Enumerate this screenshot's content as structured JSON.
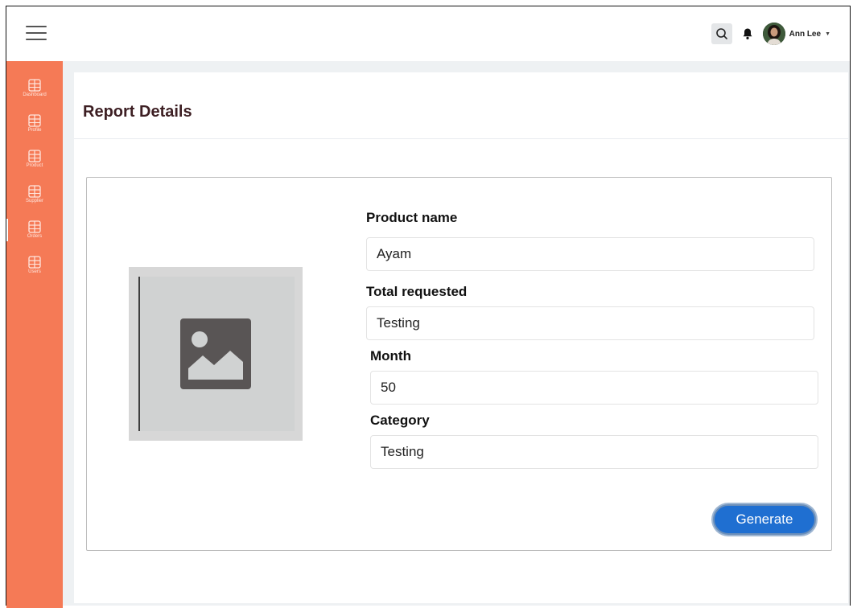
{
  "header": {
    "user_name": "Ann Lee"
  },
  "sidebar": {
    "items": [
      {
        "label": "Dashboard",
        "icon": "grid-icon"
      },
      {
        "label": "Profile",
        "icon": "grid-icon"
      },
      {
        "label": "Product",
        "icon": "grid-icon"
      },
      {
        "label": "Supplier",
        "icon": "grid-icon"
      },
      {
        "label": "Orders",
        "icon": "grid-icon"
      },
      {
        "label": "Users",
        "icon": "grid-icon"
      }
    ],
    "accent_color": "#f57a56"
  },
  "page": {
    "title": "Report Details"
  },
  "form": {
    "product_name": {
      "label": "Product name",
      "value": "Ayam"
    },
    "total_requested": {
      "label": "Total requested",
      "value": "Testing"
    },
    "month": {
      "label": "Month",
      "value": "50"
    },
    "category": {
      "label": "Category",
      "value": "Testing"
    },
    "generate_label": "Generate"
  },
  "image_placeholder_icon": "image-placeholder-icon",
  "colors": {
    "primary_button": "#1f6fd1",
    "title_text": "#3d1f23"
  }
}
